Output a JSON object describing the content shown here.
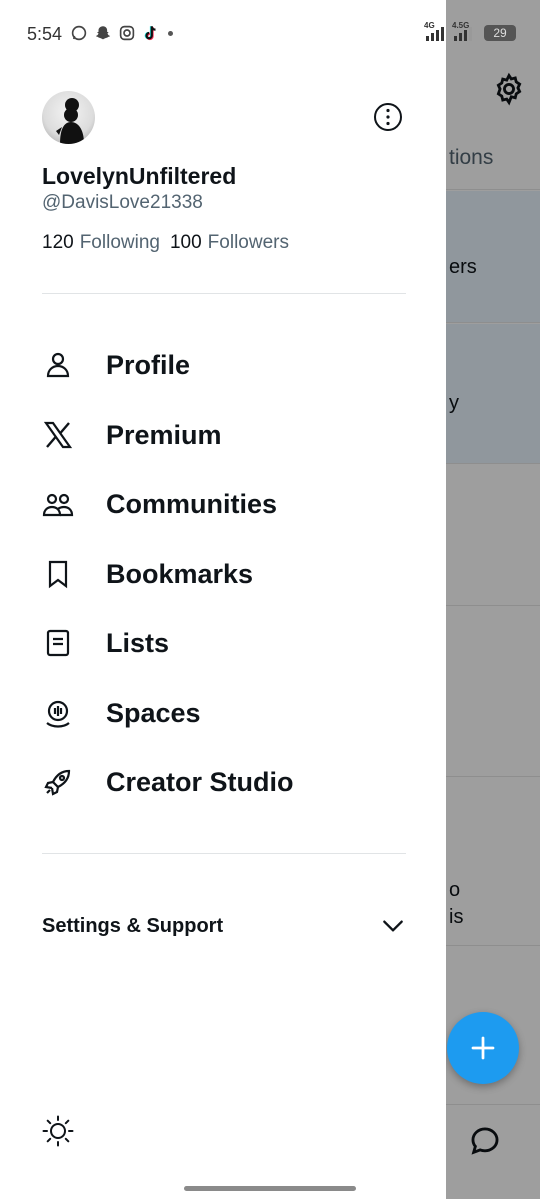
{
  "status_bar": {
    "time": "5:54",
    "icons": [
      "whatsapp-icon",
      "snapchat-icon",
      "instagram-icon",
      "tiktok-icon"
    ],
    "net1": "4G",
    "net2": "4.5G",
    "battery": "29"
  },
  "background": {
    "tab_text": "tions",
    "row1_text": "ers",
    "row2_text": "y",
    "row3_line1": "o",
    "row3_line2": "is",
    "fab_icon": "plus-icon"
  },
  "profile": {
    "display_name": "LovelynUnfiltered",
    "handle": "@DavisLove21338",
    "following_count": "120",
    "following_label": "Following",
    "followers_count": "100",
    "followers_label": "Followers"
  },
  "menu": {
    "items": [
      {
        "label": "Profile",
        "icon": "person-icon"
      },
      {
        "label": "Premium",
        "icon": "x-logo-icon"
      },
      {
        "label": "Communities",
        "icon": "communities-icon"
      },
      {
        "label": "Bookmarks",
        "icon": "bookmark-icon"
      },
      {
        "label": "Lists",
        "icon": "list-icon"
      },
      {
        "label": "Spaces",
        "icon": "spaces-icon"
      },
      {
        "label": "Creator Studio",
        "icon": "rocket-icon"
      }
    ]
  },
  "settings": {
    "label": "Settings & Support"
  },
  "colors": {
    "text": "#0f1419",
    "secondary": "#536471",
    "accent": "#1d9bf0"
  }
}
